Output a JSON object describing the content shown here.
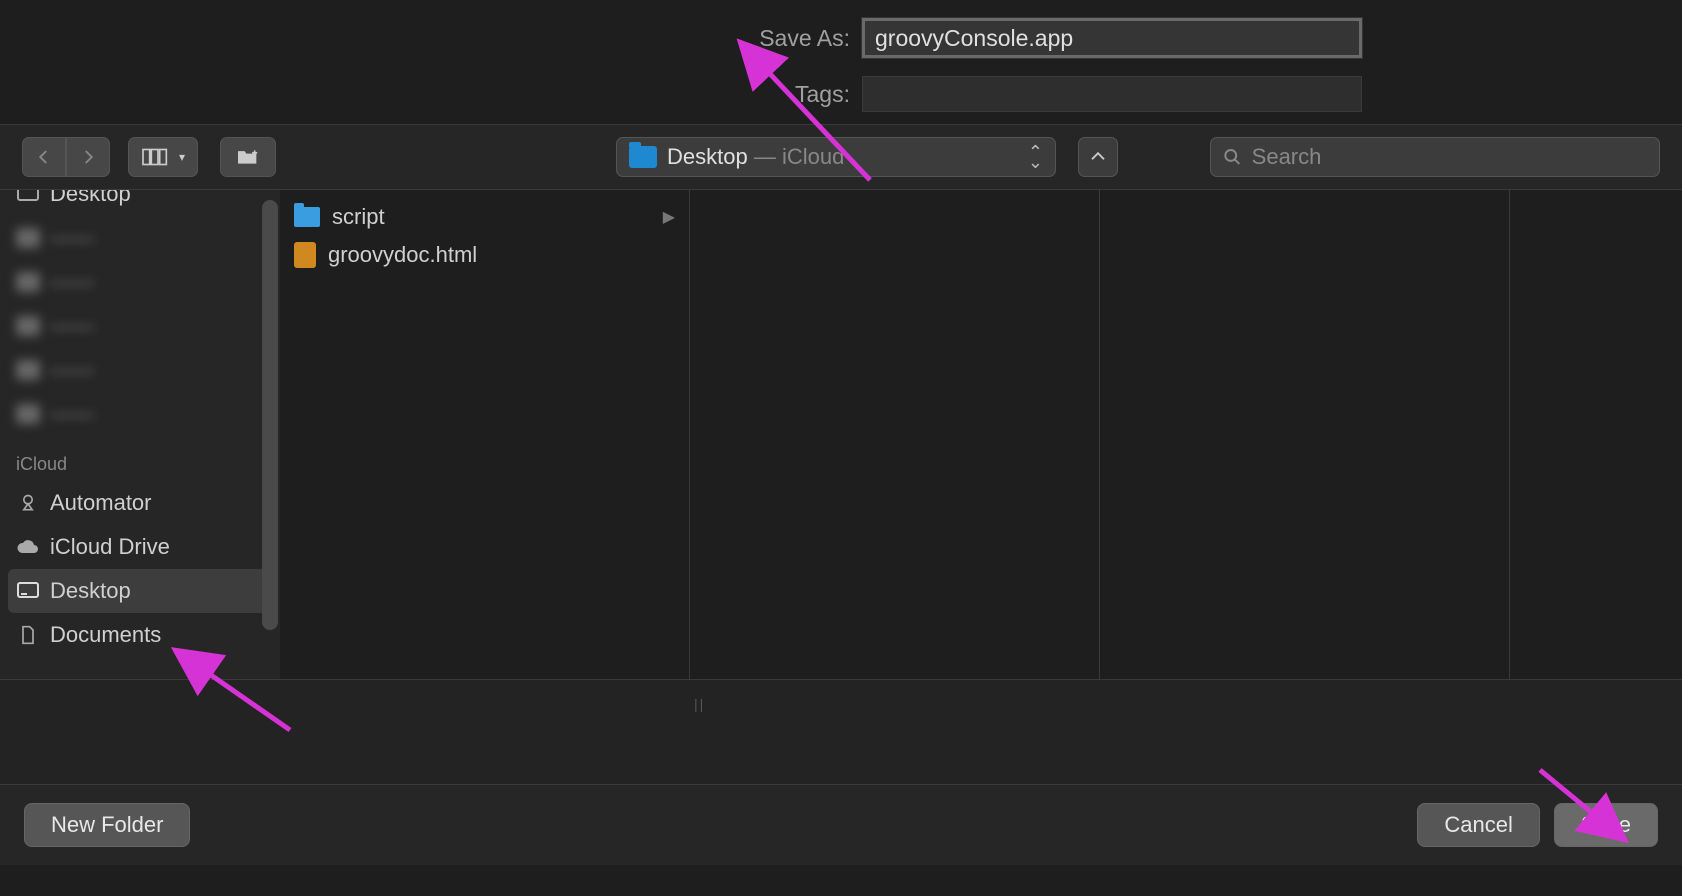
{
  "top": {
    "save_as_label": "Save As:",
    "save_as_value": "groovyConsole.app",
    "tags_label": "Tags:",
    "tags_value": ""
  },
  "toolbar": {
    "location_name": "Desktop",
    "location_suffix": " — iCloud",
    "search_placeholder": "Search"
  },
  "sidebar": {
    "partial_top": "Desktop",
    "blurred": [
      "——",
      "——",
      "——",
      "——",
      "——"
    ],
    "section_heading": "iCloud",
    "items": [
      {
        "label": "Automator",
        "icon": "automator"
      },
      {
        "label": "iCloud Drive",
        "icon": "cloud"
      },
      {
        "label": "Desktop",
        "icon": "desktop",
        "selected": true
      },
      {
        "label": "Documents",
        "icon": "documents"
      }
    ]
  },
  "column1": {
    "rows": [
      {
        "name": "script",
        "type": "folder"
      },
      {
        "name": "groovydoc.html",
        "type": "html"
      }
    ]
  },
  "footer": {
    "new_folder": "New Folder",
    "cancel": "Cancel",
    "save": "Save"
  },
  "annotations": {
    "arrow_color": "#d633d6"
  }
}
